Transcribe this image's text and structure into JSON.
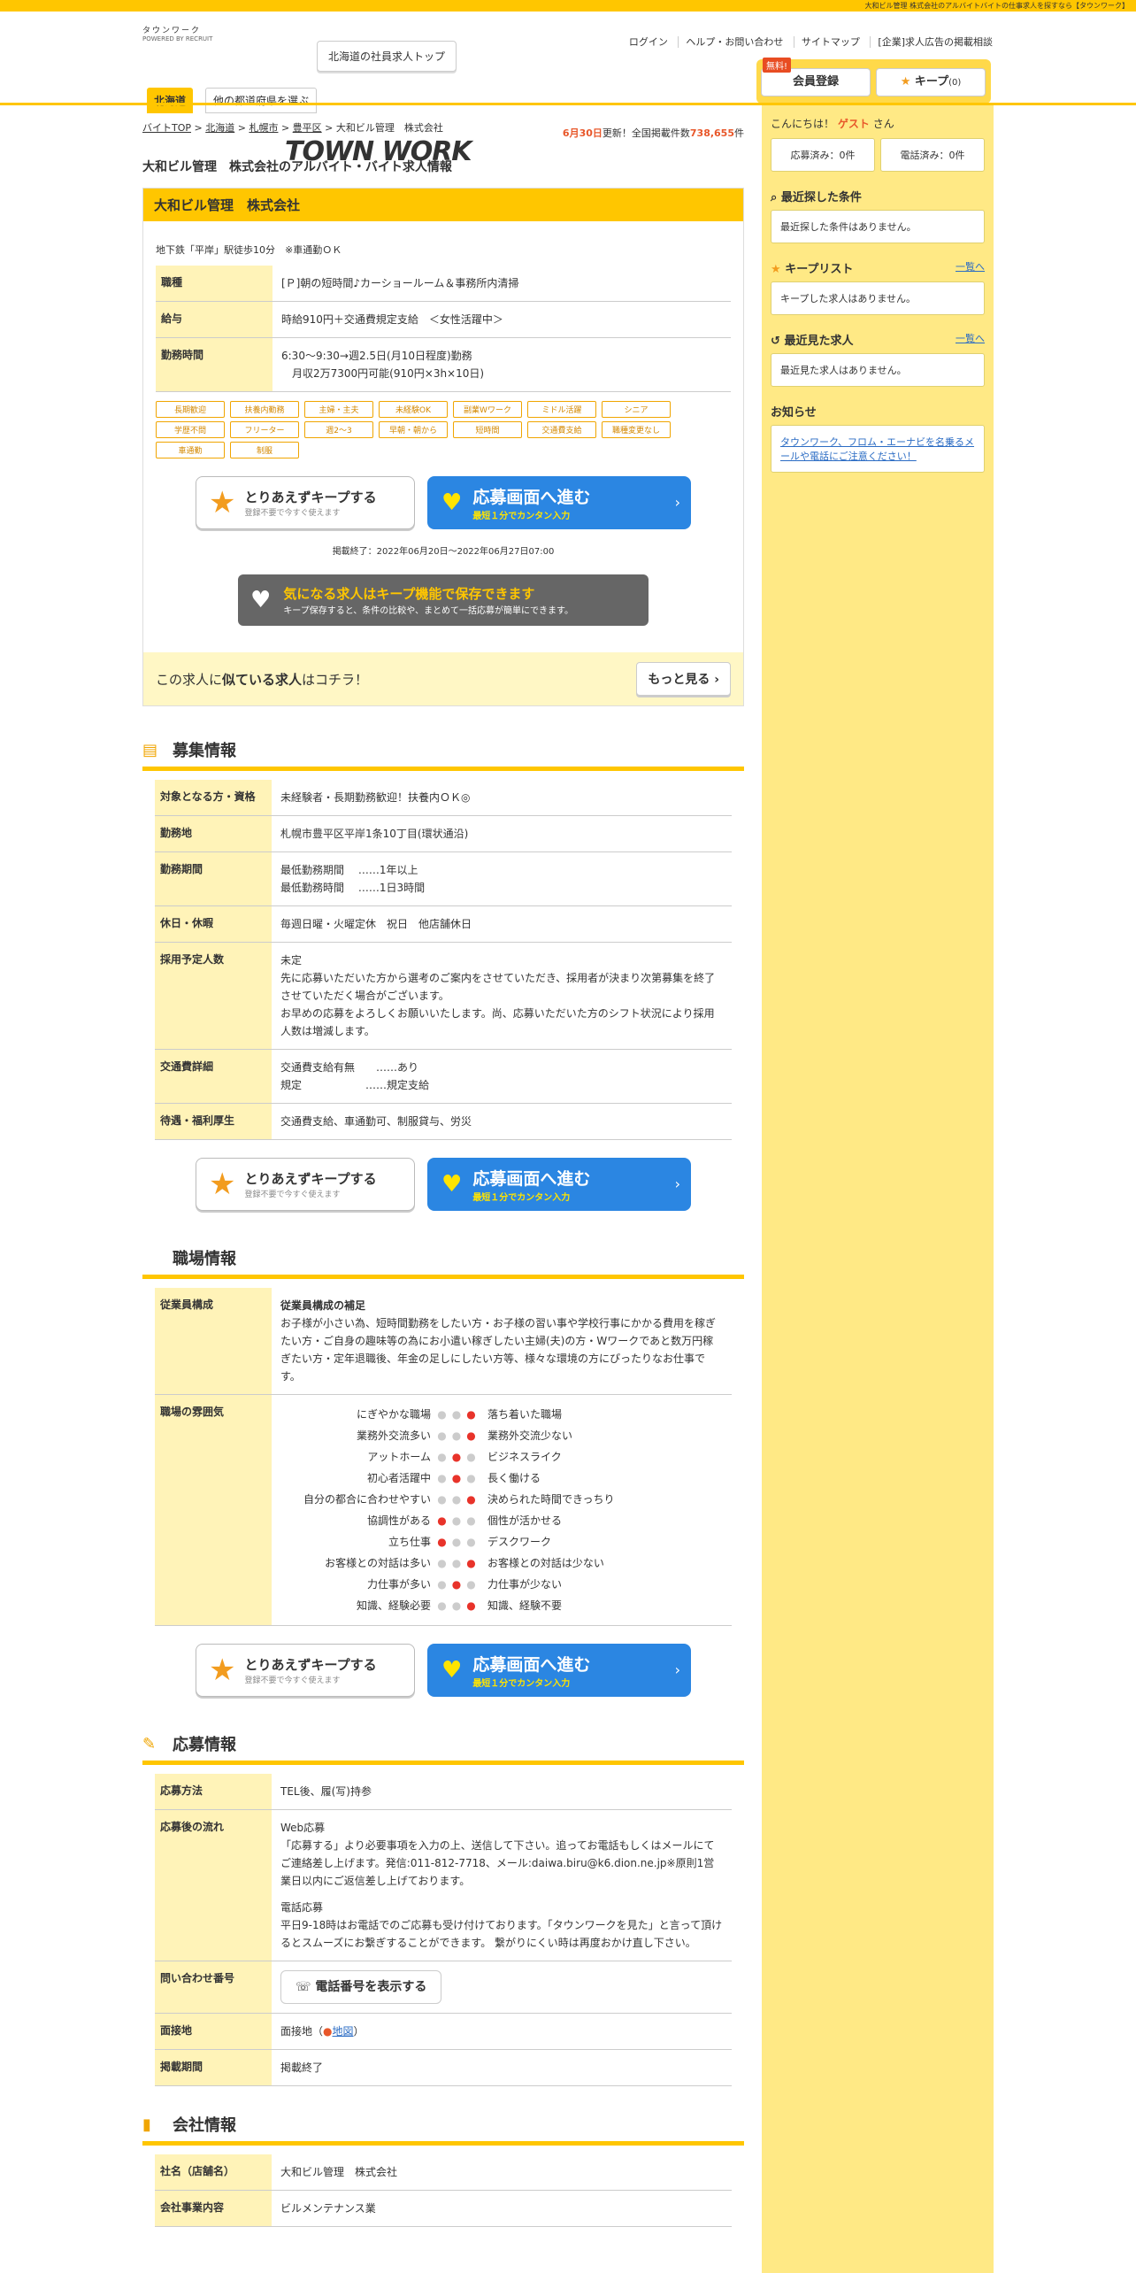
{
  "top_strip": "大和ビル管理 株式会社のアルバイトバイトの仕事求人を探すなら【タウンワーク】",
  "logo": {
    "super": "タウンワーク",
    "main": "TOWN WORK",
    "sub": "POWERED BY RECRUIT"
  },
  "header": {
    "top_button": "北海道の社員求人トップ",
    "links": [
      "ログイン",
      "ヘルプ・お問い合わせ",
      "サイトマップ",
      "[企業]求人広告の掲載相談"
    ],
    "free_badge": "無料!",
    "member_btn": "会員登録",
    "keep_btn": "キープ",
    "keep_count": "(0)",
    "region_tab": "北海道",
    "region_other": "他の都道府県を選ぶ"
  },
  "breadcrumbs": [
    "バイトTOP",
    "北海道",
    "札幌市",
    "豊平区",
    "大和ビル管理　株式会社"
  ],
  "updated": {
    "date": "6月30日",
    "text": "更新！全国掲載件数",
    "count": "738,655",
    "unit": "件"
  },
  "page_title": "大和ビル管理　株式会社のアルバイト・バイト求人情報",
  "job": {
    "company": "大和ビル管理　株式会社",
    "station": "地下鉄「平岸」駅徒歩10分　※車通勤ＯＫ",
    "rows": [
      {
        "label": "職種",
        "value": "[Ｐ]朝の短時間♪カーショールーム＆事務所内清掃"
      },
      {
        "label": "給与",
        "value": "時給910円＋交通費規定支給　＜女性活躍中＞"
      },
      {
        "label": "勤務時間",
        "value": "6:30～9:30→週2.5日(月10日程度)勤務",
        "value2": "　月収2万7300円可能(910円×3h×10日)"
      }
    ],
    "tags": [
      "長期歓迎",
      "扶養内勤務",
      "主婦・主夫",
      "未経験OK",
      "副業Wワーク",
      "ミドル活躍",
      "シニア",
      "学歴不問",
      "フリーター",
      "週2～3",
      "早朝・朝から",
      "短時間",
      "交通費支給",
      "職種変更なし",
      "車通勤",
      "制服"
    ]
  },
  "buttons": {
    "keep_t1": "とりあえずキープする",
    "keep_t2": "登録不要で今すぐ使えます",
    "apply_t1": "応募画面へ進む",
    "apply_t2": "最短１分でカンタン入力"
  },
  "period": "掲載終了：2022年06月20日～2022年06月27日07:00",
  "promo": {
    "t1": "気になる求人はキープ機能で保存できます",
    "t2": "キープ保存すると、条件の比較や、まとめて一括応募が簡単にできます。"
  },
  "similar": {
    "pre": "この求人に",
    "bold": "似ている求人",
    "post": "はコチラ！",
    "more": "もっと見る"
  },
  "recruit": {
    "title": "募集情報",
    "rows": [
      {
        "label": "対象となる方・資格",
        "lines": [
          "未経験者・長期勤務歓迎！扶養内ＯＫ◎"
        ]
      },
      {
        "label": "勤務地",
        "lines": [
          "札幌市豊平区平岸1条10丁目(環状通沿)"
        ]
      },
      {
        "label": "勤務期間",
        "lines": [
          "最低勤務期間　 ……1年以上",
          "最低勤務時間　 ……1日3時間"
        ]
      },
      {
        "label": "休日・休暇",
        "lines": [
          "毎週日曜・火曜定休　祝日　他店舗休日"
        ]
      },
      {
        "label": "採用予定人数",
        "lines": [
          "未定",
          "先に応募いただいた方から選考のご案内をさせていただき、採用者が決まり次第募集を終了させていただく場合がございます。",
          "お早めの応募をよろしくお願いいたします。尚、応募いただいた方のシフト状況により採用人数は増減します。"
        ]
      },
      {
        "label": "交通費詳細",
        "lines": [
          "交通費支給有無　　……あり",
          "規定　　　　　　……規定支給"
        ]
      },
      {
        "label": "待遇・福利厚生",
        "lines": [
          "交通費支給、車通勤可、制服貸与、労災"
        ]
      }
    ]
  },
  "workplace": {
    "title": "職場情報",
    "staff_label": "従業員構成",
    "staff_head": "従業員構成の補足",
    "staff_text": "お子様が小さい為、短時間勤務をしたい方・お子様の習い事や学校行事にかかる費用を稼ぎたい方・ご自身の趣味等の為にお小遣い稼ぎしたい主婦(夫)の方・Wワークであと数万円稼ぎたい方・定年退職後、年金の足しにしたい方等、様々な環境の方にぴったりなお仕事です。",
    "atm_label": "職場の雰囲気",
    "atmosphere": [
      {
        "left": "にぎやかな職場",
        "right": "落ち着いた職場",
        "pos": 3
      },
      {
        "left": "業務外交流多い",
        "right": "業務外交流少ない",
        "pos": 3
      },
      {
        "left": "アットホーム",
        "right": "ビジネスライク",
        "pos": 2
      },
      {
        "left": "初心者活躍中",
        "right": "長く働ける",
        "pos": 2
      },
      {
        "left": "自分の都合に合わせやすい",
        "right": "決められた時間できっちり",
        "pos": 3
      },
      {
        "left": "協調性がある",
        "right": "個性が活かせる",
        "pos": 1
      },
      {
        "left": "立ち仕事",
        "right": "デスクワーク",
        "pos": 1
      },
      {
        "left": "お客様との対話は多い",
        "right": "お客様との対話は少ない",
        "pos": 3
      },
      {
        "left": "力仕事が多い",
        "right": "力仕事が少ない",
        "pos": 2
      },
      {
        "left": "知識、経験必要",
        "right": "知識、経験不要",
        "pos": 3
      }
    ]
  },
  "apply": {
    "title": "応募情報",
    "method_label": "応募方法",
    "method": "TEL後、履(写)持参",
    "flow_label": "応募後の流れ",
    "flow": [
      "Web応募",
      "「応募する」より必要事項を入力の上、送信して下さい。追ってお電話もしくはメールにてご連絡差し上げます。発信:011-812-7718、メール:daiwa.biru@k6.dion.ne.jp※原則1営業日以内にご返信差し上げております。",
      "電話応募",
      "平日9-18時はお電話でのご応募も受け付けております。「タウンワークを見た」と言って頂けるとスムーズにお繋ぎすることができます。 繋がりにくい時は再度おかけ直し下さい。"
    ],
    "phone_label": "問い合わせ番号",
    "phone_btn": "電話番号を表示する",
    "interview_label": "面接地",
    "interview": "面接地",
    "map": "地図",
    "period_label": "掲載期間",
    "period_value": "掲載終了"
  },
  "company": {
    "title": "会社情報",
    "rows": [
      {
        "label": "社名（店舗名）",
        "value": "大和ビル管理　株式会社"
      },
      {
        "label": "会社事業内容",
        "value": "ビルメンテナンス業"
      }
    ]
  },
  "sidebar": {
    "greeting_pre": "こんにちは！",
    "guest": "ゲスト",
    "greeting_post": "さん",
    "applied": "応募済み：0件",
    "called": "電話済み：0件",
    "recent_search": "最近探した条件",
    "recent_search_empty": "最近探した条件はありません。",
    "keeplist": "キープリスト",
    "keeplist_link": "一覧へ",
    "keeplist_empty": "キープした求人はありません。",
    "recent_view": "最近見た求人",
    "recent_view_link": "一覧へ",
    "recent_view_empty": "最近見た求人はありません。",
    "notice": "お知らせ",
    "notice_text": "タウンワーク、フロム・エーナビを名乗るメールや電話にご注意ください！"
  }
}
